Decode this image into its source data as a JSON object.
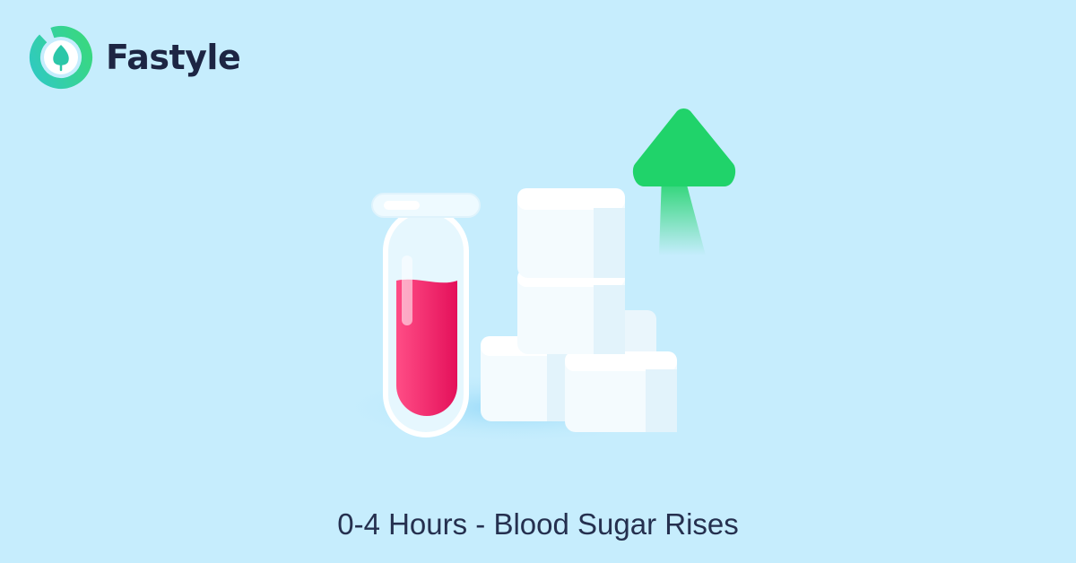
{
  "brand": {
    "name": "Fastyle",
    "logo_icon": "leaf-ring-icon"
  },
  "illustration": {
    "tube_icon": "test-tube-icon",
    "cubes_icon": "sugar-cubes-icon",
    "arrow_icon": "arrow-up-icon"
  },
  "caption": "0-4 Hours - Blood Sugar Rises",
  "colors": {
    "background": "#c6edfd",
    "brand_text": "#1d2543",
    "blood": "#ee1f68",
    "arrow": "#20d36a",
    "logo_teal": "#2fc9c4",
    "logo_green": "#39d97a"
  }
}
